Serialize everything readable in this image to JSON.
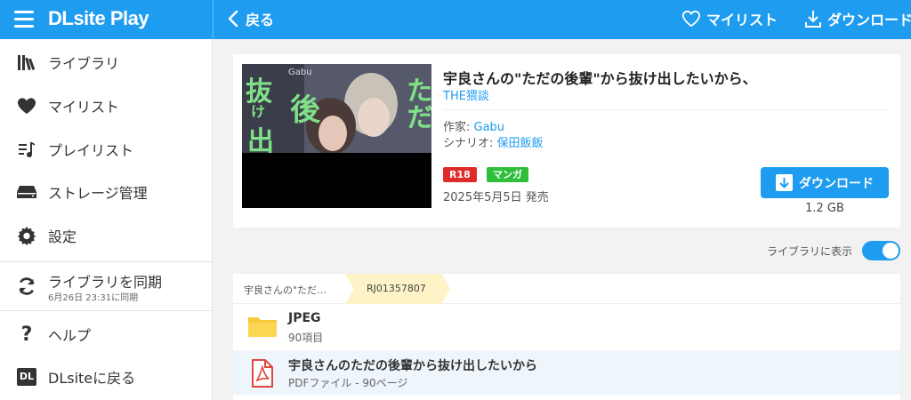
{
  "app": {
    "logo": "DLsite Play"
  },
  "topbar": {
    "back_label": "戻る",
    "mylist_label": "マイリスト",
    "download_label": "ダウンロード"
  },
  "sidebar": {
    "items": [
      {
        "label": "ライブラリ",
        "icon": "library-icon"
      },
      {
        "label": "マイリスト",
        "icon": "heart-icon"
      },
      {
        "label": "プレイリスト",
        "icon": "playlist-icon"
      },
      {
        "label": "ストレージ管理",
        "icon": "storage-icon"
      },
      {
        "label": "設定",
        "icon": "gear-icon"
      },
      {
        "label": "ライブラリを同期",
        "sub": "6月26日 23:31に同期",
        "icon": "sync-icon"
      },
      {
        "label": "ヘルプ",
        "icon": "help-icon"
      },
      {
        "label": "DLsiteに戻る",
        "icon": "dlsite-icon"
      }
    ]
  },
  "work": {
    "title": "宇良さんの\"ただの後輩\"から抜け出したいから、",
    "circle": "THE猥談",
    "author_label": "作家: ",
    "author": "Gabu",
    "scenario_label": "シナリオ: ",
    "scenario": "保田飯飯",
    "badges": [
      "R18",
      "マンガ"
    ],
    "release": "2025年5月5日 発売",
    "download_button": "ダウンロード",
    "size": "1.2 GB",
    "cover_text": [
      "抜",
      "け",
      "出",
      "後",
      "ただ",
      "Gabu"
    ]
  },
  "library_toggle": {
    "label": "ライブラリに表示",
    "on": true
  },
  "breadcrumb": {
    "parent": "宇良さんの\"ただ…",
    "current": "RJ01357807"
  },
  "files": [
    {
      "name": "JPEG",
      "sub": "90項目",
      "type": "folder"
    },
    {
      "name": "宇良さんのただの後輩から抜け出したいから",
      "sub": "PDFファイル - 90ページ",
      "type": "pdf"
    }
  ],
  "colors": {
    "accent": "#1e9cf0",
    "r18": "#e02b2b",
    "manga": "#2fbf3b",
    "folder": "#f7c936",
    "pdf": "#e0463d"
  }
}
